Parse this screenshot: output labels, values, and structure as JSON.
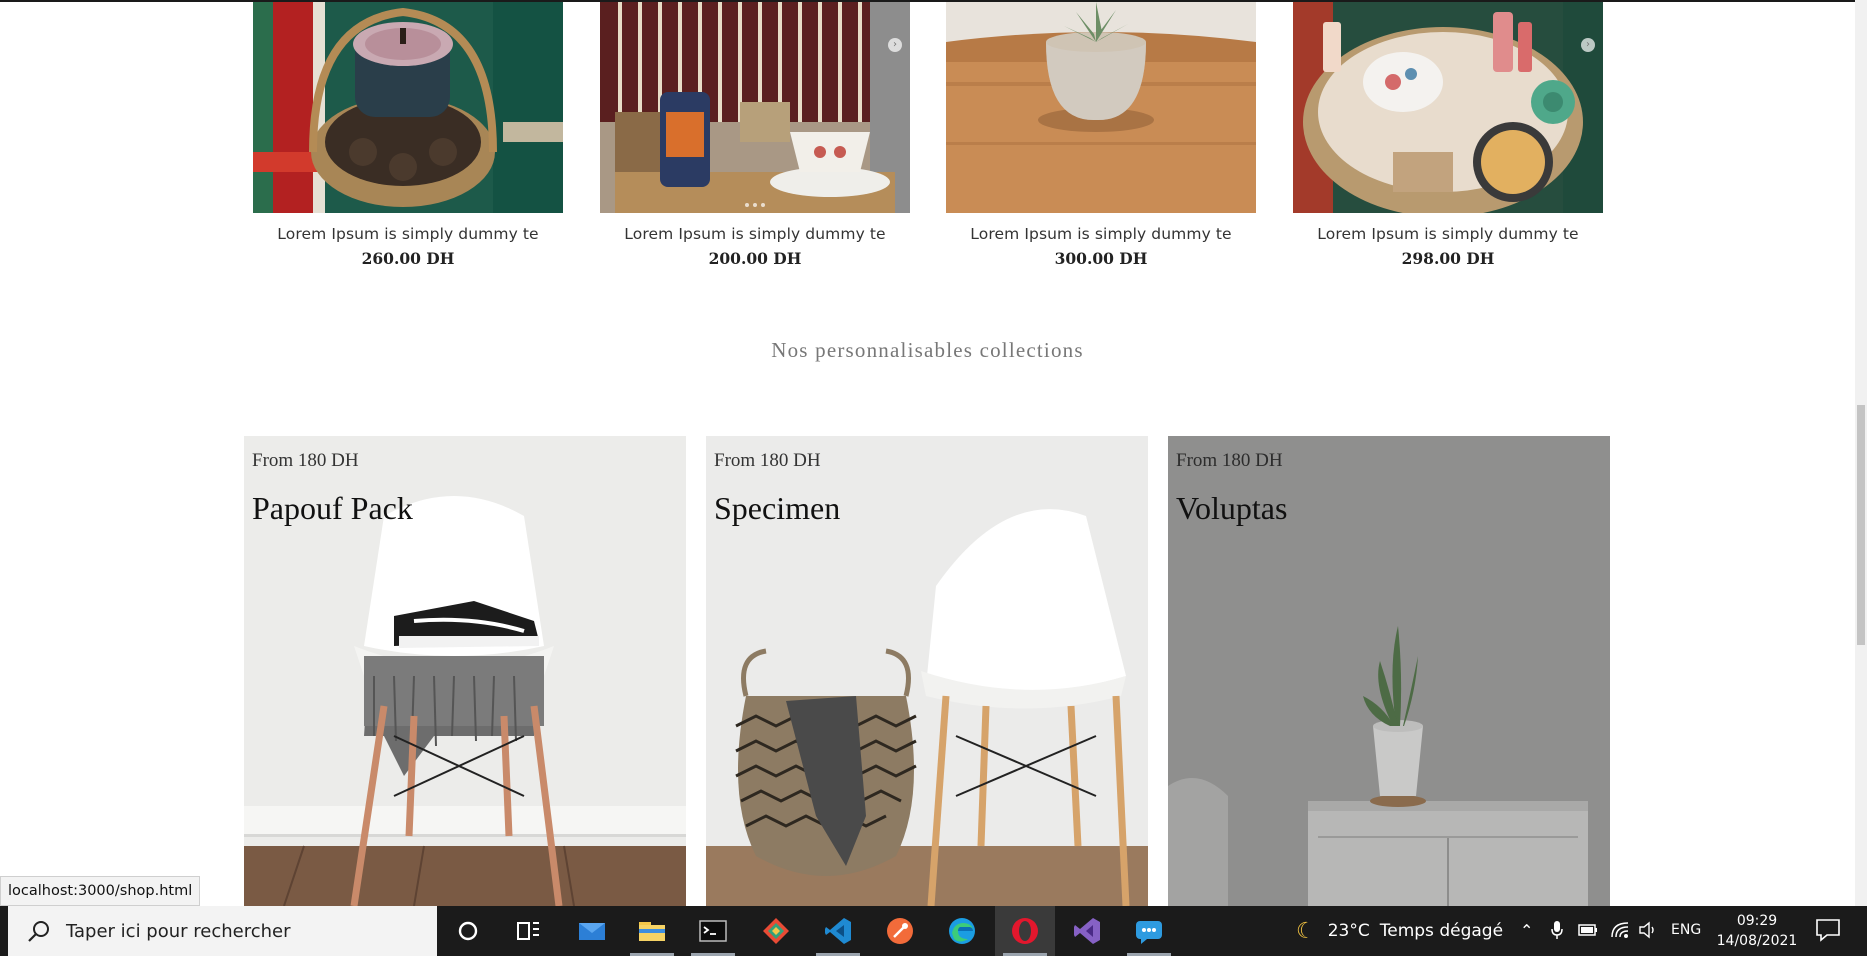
{
  "products": [
    {
      "name": "Lorem Ipsum is simply dummy te",
      "price": "260.00 DH"
    },
    {
      "name": "Lorem Ipsum is simply dummy te",
      "price": "200.00 DH"
    },
    {
      "name": "Lorem Ipsum is simply dummy te",
      "price": "300.00 DH"
    },
    {
      "name": "Lorem Ipsum is simply dummy te",
      "price": "298.00 DH"
    }
  ],
  "collections_section": {
    "title": "Nos personnalisables collections",
    "items": [
      {
        "from": "From 180 DH",
        "name": "Papouf Pack"
      },
      {
        "from": "From 180 DH",
        "name": "Specimen"
      },
      {
        "from": "From 180 DH",
        "name": "Voluptas"
      }
    ]
  },
  "status_bar": {
    "url": "localhost:3000/shop.html"
  },
  "taskbar": {
    "search_placeholder": "Taper ici pour rechercher",
    "apps": [
      "cortana-icon",
      "task-view-icon",
      "mail-icon",
      "file-explorer-icon",
      "terminal-icon",
      "git-kraken-icon",
      "vscode-icon",
      "postman-icon",
      "edge-icon",
      "opera-icon",
      "visual-studio-icon",
      "chat-icon"
    ],
    "weather": {
      "temp": "23°C",
      "text": "Temps dégagé"
    },
    "language": "ENG",
    "time": "09:29",
    "date": "14/08/2021"
  }
}
